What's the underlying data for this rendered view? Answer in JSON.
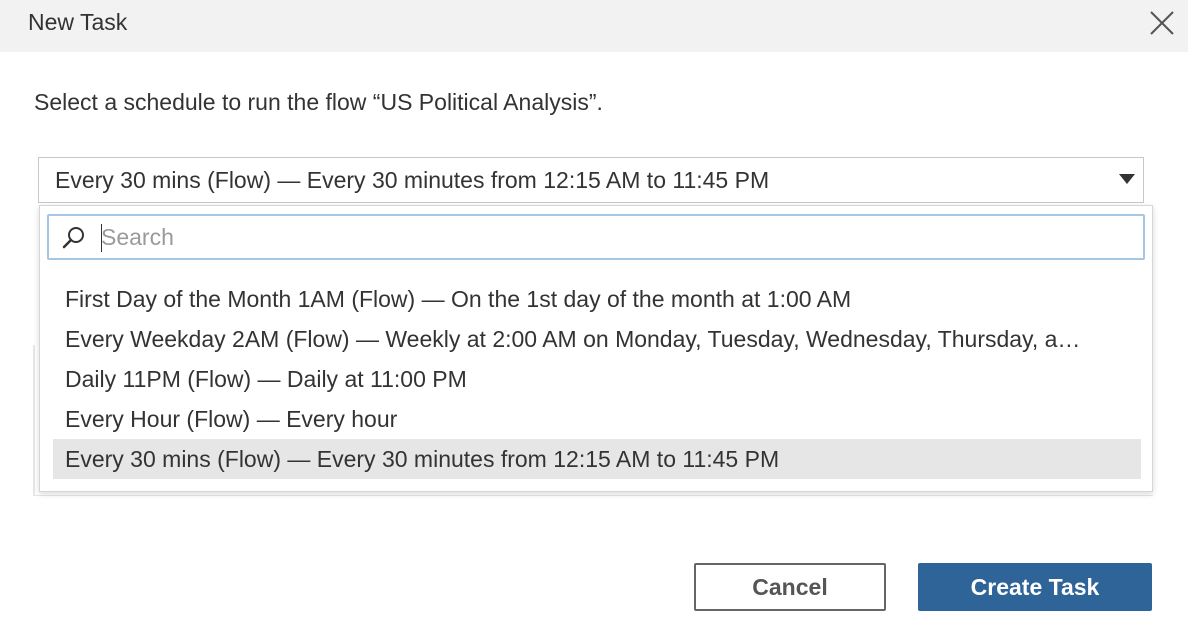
{
  "dialog": {
    "title": "New Task",
    "prompt": "Select a schedule to run the flow “US Political Analysis”."
  },
  "schedule_select": {
    "value": "Every 30 mins (Flow) — Every 30 minutes from 12:15 AM to 11:45 PM",
    "search_placeholder": "Search",
    "options": [
      "First Day of the Month 1AM (Flow) — On the 1st day of the month at 1:00 AM",
      "Every Weekday 2AM (Flow) — Weekly at 2:00 AM on Monday, Tuesday, Wednesday, Thursday, a…",
      "Daily 11PM (Flow) — Daily at 11:00 PM",
      "Every Hour (Flow) — Every hour",
      "Every 30 mins (Flow) — Every 30 minutes from 12:15 AM to 11:45 PM"
    ],
    "selected_index": 4
  },
  "buttons": {
    "cancel": "Cancel",
    "create": "Create Task"
  },
  "colors": {
    "primary": "#2f6499",
    "search_focus": "#a7c6e4",
    "selected_bg": "#e6e6e6"
  }
}
